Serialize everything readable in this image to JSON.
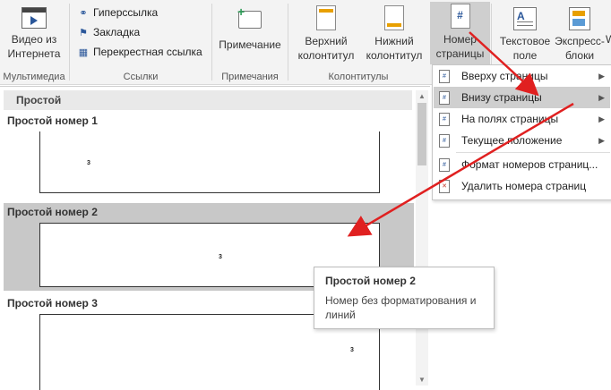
{
  "ribbon": {
    "groups": {
      "media": "Мультимедиа",
      "links": "Ссылки",
      "comments": "Примечания",
      "header_footer": "Колонтитулы"
    },
    "video": {
      "line1": "Видео из",
      "line2": "Интернета"
    },
    "links": {
      "hyperlink": "Гиперссылка",
      "bookmark": "Закладка",
      "cross_ref": "Перекрестная ссылка"
    },
    "comment": "Примечание",
    "header": {
      "line1": "Верхний",
      "line2": "колонтитул"
    },
    "footer": {
      "line1": "Нижний",
      "line2": "колонтитул"
    },
    "page_number": {
      "line1": "Номер",
      "line2": "страницы",
      "icon": "#"
    },
    "text_field": {
      "line1": "Текстовое",
      "line2": "поле"
    },
    "express": {
      "line1": "Экспресс-",
      "line2": "блоки"
    },
    "more": "W"
  },
  "gallery": {
    "header": "Простой",
    "items": [
      {
        "title": "Простой номер 1",
        "number": "3"
      },
      {
        "title": "Простой номер 2",
        "number": "3"
      },
      {
        "title": "Простой номер 3",
        "number": "3"
      }
    ]
  },
  "menu": {
    "items": [
      {
        "label": "Вверху страницы",
        "icon": "#"
      },
      {
        "label": "Внизу страницы",
        "icon": "#"
      },
      {
        "label": "На полях страницы",
        "icon": "#"
      },
      {
        "label": "Текущее положение",
        "icon": "#"
      },
      {
        "label": "Формат номеров страниц...",
        "icon": "#"
      },
      {
        "label": "Удалить номера страниц",
        "icon": "✕"
      }
    ]
  },
  "tooltip": {
    "title": "Простой номер 2",
    "body": "Номер без форматирования и линий"
  },
  "colors": {
    "accent": "#2b579a",
    "annotation_arrow": "#e02020",
    "highlight": "#cfcfcf"
  }
}
